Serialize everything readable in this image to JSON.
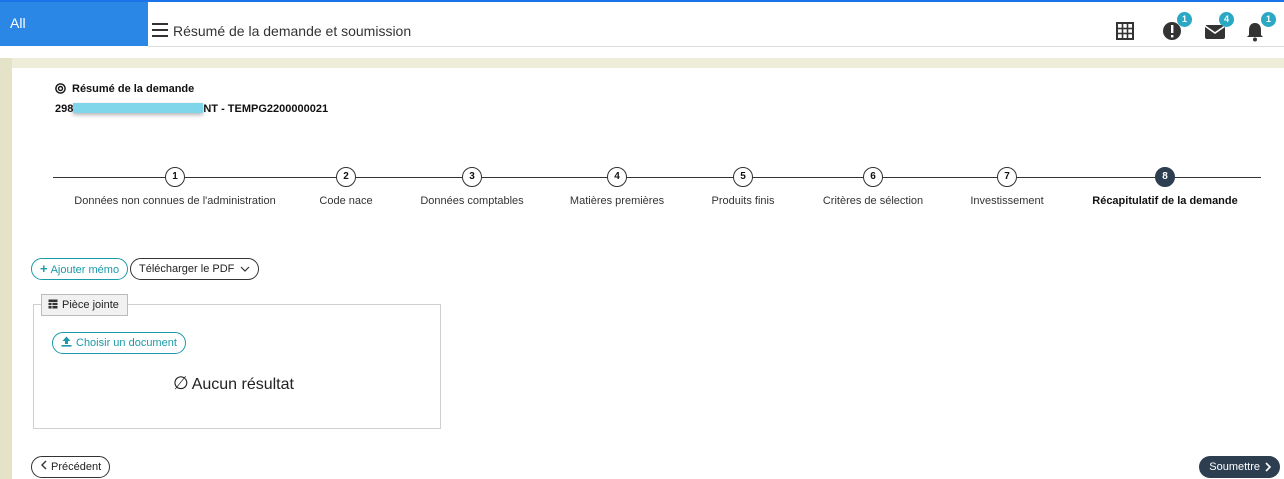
{
  "header": {
    "all_tab": "All",
    "title": "Résumé de la demande et soumission",
    "icons": [
      {
        "name": "grid-icon",
        "badge": ""
      },
      {
        "name": "alert-icon",
        "badge": "1"
      },
      {
        "name": "mail-icon",
        "badge": "4"
      },
      {
        "name": "bell-icon",
        "badge": "1"
      }
    ]
  },
  "summary": {
    "title": "Résumé de la demande",
    "ref_prefix": "298",
    "ref_suffix": "NT - TEMPG2200000021"
  },
  "steps": [
    {
      "num": "1",
      "label": "Données non connues de l'administration"
    },
    {
      "num": "2",
      "label": "Code nace"
    },
    {
      "num": "3",
      "label": "Données comptables"
    },
    {
      "num": "4",
      "label": "Matières premières"
    },
    {
      "num": "5",
      "label": "Produits finis"
    },
    {
      "num": "6",
      "label": "Critères de sélection"
    },
    {
      "num": "7",
      "label": "Investissement"
    },
    {
      "num": "8",
      "label": "Récapitulatif de la demande",
      "active": true
    }
  ],
  "actions": {
    "add_memo": "Ajouter mémo",
    "download_pdf": "Télécharger le PDF"
  },
  "attachment": {
    "legend": "Pièce jointe",
    "choose_doc": "Choisir un document",
    "empty": "Aucun résultat"
  },
  "footer": {
    "previous": "Précédent",
    "submit": "Soumettre"
  },
  "colors": {
    "accent": "#2a87e6",
    "teal": "#1a9aa8",
    "dark": "#2d3e50",
    "badge": "#2aa8c4"
  }
}
